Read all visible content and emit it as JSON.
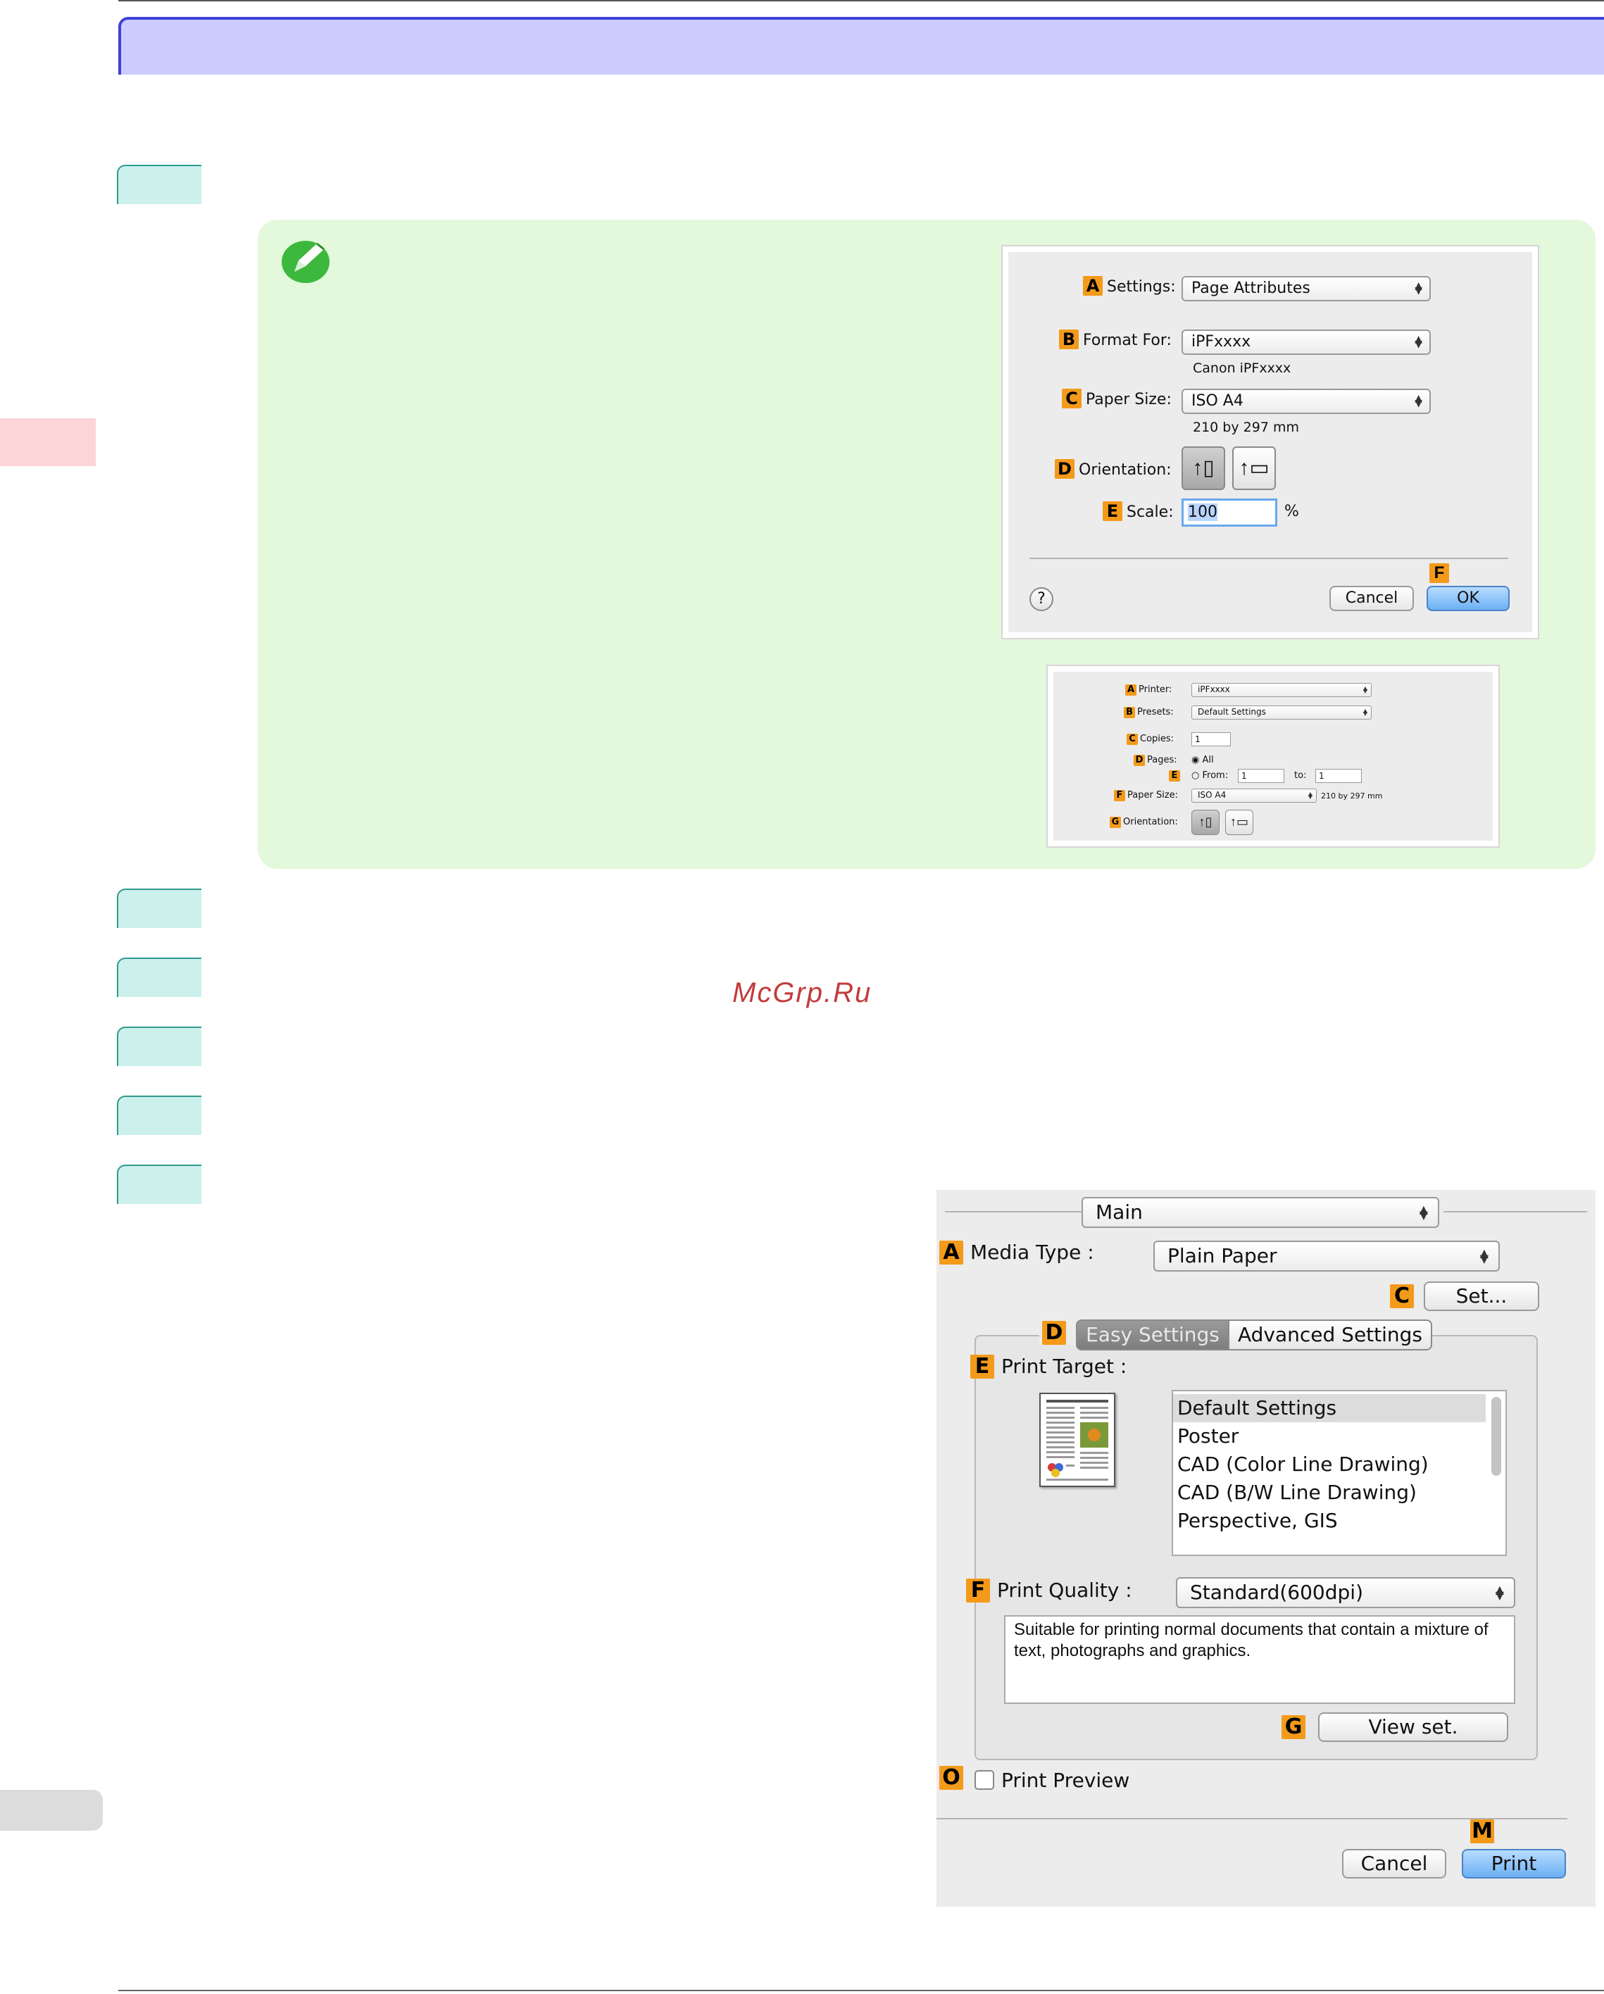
{
  "watermark": "McGrp.Ru",
  "page_setup_dialog": {
    "settings": {
      "marker": "A",
      "label": "Settings:",
      "value": "Page Attributes"
    },
    "format_for": {
      "marker": "B",
      "label": "Format For:",
      "value": "iPFxxxx",
      "sub": "Canon iPFxxxx"
    },
    "paper_size": {
      "marker": "C",
      "label": "Paper Size:",
      "value": "ISO A4",
      "sub": "210 by 297 mm"
    },
    "orientation": {
      "marker": "D",
      "label": "Orientation:"
    },
    "scale": {
      "marker": "E",
      "label": "Scale:",
      "value": "100",
      "unit": "%"
    },
    "help": "?",
    "ok_marker": "F",
    "cancel_label": "Cancel",
    "ok_label": "OK"
  },
  "print_dialog_small": {
    "printer": {
      "marker": "A",
      "label": "Printer:",
      "value": "iPFxxxx"
    },
    "presets": {
      "marker": "B",
      "label": "Presets:",
      "value": "Default Settings"
    },
    "copies": {
      "marker": "C",
      "label": "Copies:",
      "value": "1"
    },
    "pages": {
      "marker": "D",
      "label": "Pages:",
      "all_label": "All"
    },
    "range": {
      "marker": "E",
      "from_label": "From:",
      "from_value": "1",
      "to_label": "to:",
      "to_value": "1"
    },
    "paper_size": {
      "marker": "F",
      "label": "Paper Size:",
      "value": "ISO A4",
      "sub": "210 by 297 mm"
    },
    "orientation": {
      "marker": "G",
      "label": "Orientation:"
    }
  },
  "print_dialog_main": {
    "panel_value": "Main",
    "media_type": {
      "marker": "A",
      "label": "Media Type :",
      "value": "Plain Paper"
    },
    "set_button": {
      "marker": "C",
      "label": "Set..."
    },
    "tabs": {
      "marker": "D",
      "easy": "Easy Settings",
      "advanced": "Advanced Settings"
    },
    "print_target": {
      "marker": "E",
      "label": "Print Target :",
      "items": [
        "Default Settings",
        "Poster",
        "CAD (Color Line Drawing)",
        "CAD (B/W Line Drawing)",
        "Perspective, GIS"
      ]
    },
    "print_quality": {
      "marker": "F",
      "label": "Print Quality :",
      "value": "Standard(600dpi)",
      "description": "Suitable for printing normal documents that contain a mixture of text, photographs and graphics."
    },
    "view_set": {
      "marker": "G",
      "label": "View set."
    },
    "print_preview": {
      "marker": "O",
      "label": "Print Preview"
    },
    "print_marker": "M",
    "cancel_label": "Cancel",
    "print_label": "Print"
  },
  "colors": {
    "accent": "#4040d8",
    "title_fill": "#ccccff",
    "note_fill": "#e4f8dc",
    "step_tab": "#ccf0ec",
    "marker": "#f39a1a"
  }
}
